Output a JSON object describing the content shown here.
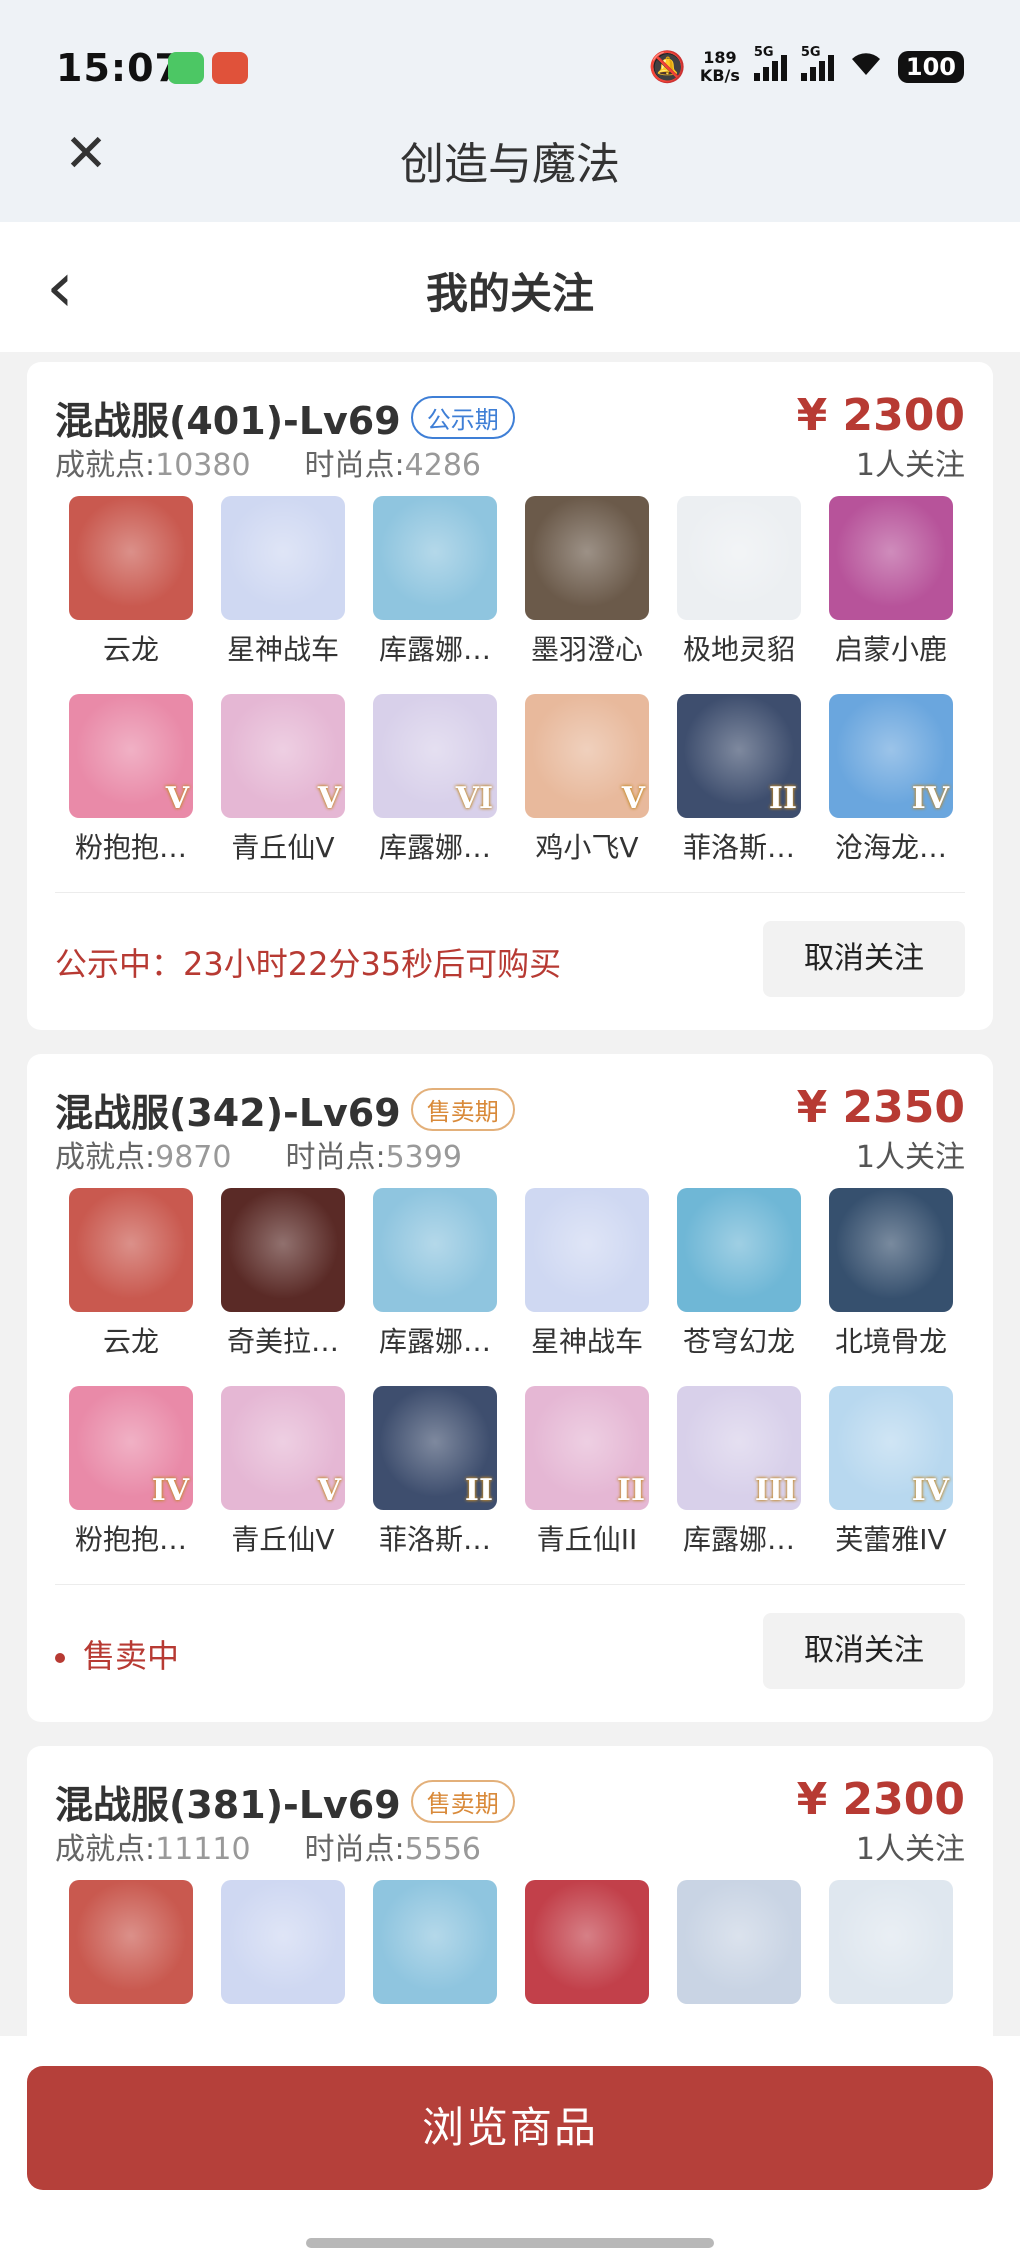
{
  "status_bar": {
    "time": "15:07",
    "net_speed_value": "189",
    "net_speed_unit": "KB/s",
    "sim1": "5G",
    "sim2": "5G",
    "battery": "100"
  },
  "app": {
    "title": "创造与魔法"
  },
  "page": {
    "title": "我的关注"
  },
  "cards": [
    {
      "server": "混战服(401)-Lv69",
      "tag": "公示期",
      "tag_style": "notice",
      "price": "¥ 2300",
      "followers": "1人关注",
      "achievement_label": "成就点:",
      "achievement_value": "10380",
      "fashion_label": "时尚点:",
      "fashion_value": "4286",
      "items": [
        {
          "name": "云龙",
          "rank": "",
          "color": "#c9594f"
        },
        {
          "name": "星神战车",
          "rank": "",
          "color": "#cfd8f2"
        },
        {
          "name": "库露娜…",
          "rank": "",
          "color": "#8fc5df"
        },
        {
          "name": "墨羽澄心",
          "rank": "",
          "color": "#6b5a4a"
        },
        {
          "name": "极地灵貂",
          "rank": "",
          "color": "#eceff2"
        },
        {
          "name": "启蒙小鹿",
          "rank": "",
          "color": "#b7539a"
        },
        {
          "name": "粉抱抱…",
          "rank": "V",
          "color": "#e98aa8"
        },
        {
          "name": "青丘仙V",
          "rank": "V",
          "color": "#e5b7d4"
        },
        {
          "name": "库露娜…",
          "rank": "VI",
          "color": "#d8d0ea"
        },
        {
          "name": "鸡小飞V",
          "rank": "V",
          "color": "#e8b99c"
        },
        {
          "name": "菲洛斯…",
          "rank": "II",
          "color": "#3e4e6e"
        },
        {
          "name": "沧海龙…",
          "rank": "IV",
          "color": "#6aa6de"
        }
      ],
      "status_text": "公示中：23小时22分35秒后可购买",
      "show_dot": false,
      "unfollow": "取消关注"
    },
    {
      "server": "混战服(342)-Lv69",
      "tag": "售卖期",
      "tag_style": "sale",
      "price": "¥ 2350",
      "followers": "1人关注",
      "achievement_label": "成就点:",
      "achievement_value": "9870",
      "fashion_label": "时尚点:",
      "fashion_value": "5399",
      "items": [
        {
          "name": "云龙",
          "rank": "",
          "color": "#c9594f"
        },
        {
          "name": "奇美拉…",
          "rank": "",
          "color": "#5a2a26"
        },
        {
          "name": "库露娜…",
          "rank": "",
          "color": "#8fc5df"
        },
        {
          "name": "星神战车",
          "rank": "",
          "color": "#cfd8f2"
        },
        {
          "name": "苍穹幻龙",
          "rank": "",
          "color": "#6fb7d6"
        },
        {
          "name": "北境骨龙",
          "rank": "",
          "color": "#36506e"
        },
        {
          "name": "粉抱抱…",
          "rank": "IV",
          "color": "#e98aa8"
        },
        {
          "name": "青丘仙V",
          "rank": "V",
          "color": "#e5b7d4"
        },
        {
          "name": "菲洛斯…",
          "rank": "II",
          "color": "#3e4e6e"
        },
        {
          "name": "青丘仙II",
          "rank": "II",
          "color": "#e5b7d4"
        },
        {
          "name": "库露娜…",
          "rank": "III",
          "color": "#d8d0ea"
        },
        {
          "name": "芙蕾雅IV",
          "rank": "IV",
          "color": "#b8d8ef"
        }
      ],
      "status_text": "售卖中",
      "show_dot": true,
      "unfollow": "取消关注"
    },
    {
      "server": "混战服(381)-Lv69",
      "tag": "售卖期",
      "tag_style": "sale",
      "price": "¥ 2300",
      "followers": "1人关注",
      "achievement_label": "成就点:",
      "achievement_value": "11110",
      "fashion_label": "时尚点:",
      "fashion_value": "5556",
      "items": [
        {
          "name": "",
          "rank": "",
          "color": "#c9594f"
        },
        {
          "name": "",
          "rank": "",
          "color": "#cfd8f2"
        },
        {
          "name": "",
          "rank": "",
          "color": "#8fc5df"
        },
        {
          "name": "",
          "rank": "",
          "color": "#c2404a"
        },
        {
          "name": "",
          "rank": "",
          "color": "#c9d4e4"
        },
        {
          "name": "",
          "rank": "",
          "color": "#dfe7ef"
        }
      ],
      "status_text": "",
      "show_dot": false,
      "unfollow": ""
    }
  ],
  "bottom": {
    "browse_button": "浏览商品"
  }
}
